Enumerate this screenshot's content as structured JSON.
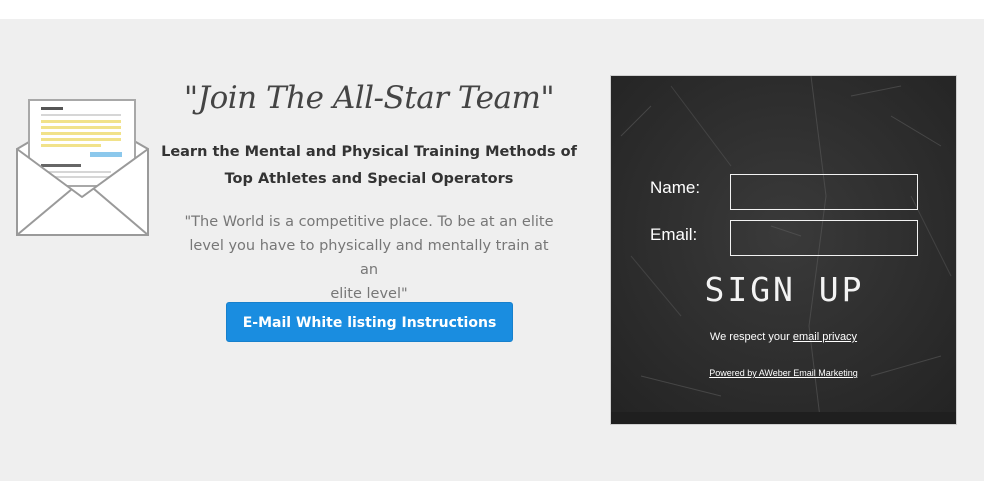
{
  "hero": {
    "headline": "\"Join The All-Star Team\"",
    "subhead_line1": "Learn the Mental and Physical Training Methods of",
    "subhead_line2": "Top Athletes and Special Operators",
    "quote_line1": "\"The World is a competitive place. To be at an elite",
    "quote_line2": "level you have to physically and mentally train at an",
    "quote_line3": "elite level\"",
    "cta_label": "E-Mail White listing Instructions",
    "cta_color": "#1a8de0",
    "icon": "envelope-icon"
  },
  "signup_form": {
    "name_label": "Name:",
    "name_value": "",
    "email_label": "Email:",
    "email_value": "",
    "submit_label": "SIGN UP",
    "privacy_prefix": "We respect your ",
    "privacy_link": "email privacy",
    "powered_by": "Powered by AWeber Email Marketing",
    "board_color": "#2d2d2d"
  }
}
